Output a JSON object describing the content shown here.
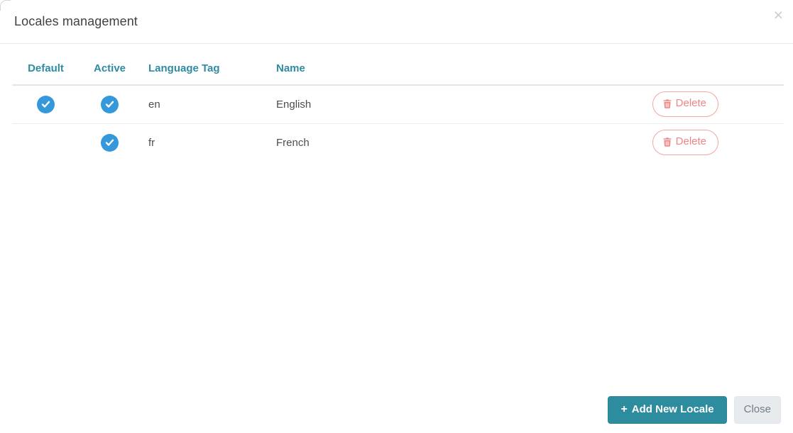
{
  "modal": {
    "title": "Locales management",
    "close_glyph": "×"
  },
  "table": {
    "headers": [
      {
        "label": "Default"
      },
      {
        "label": "Active"
      },
      {
        "label": "Language Tag"
      },
      {
        "label": "Name"
      },
      {
        "label": ""
      }
    ],
    "rows": [
      {
        "default": true,
        "active": true,
        "language_tag": "en",
        "name": "English",
        "delete_label": "Delete"
      },
      {
        "default": false,
        "active": true,
        "language_tag": "fr",
        "name": "French",
        "delete_label": "Delete"
      }
    ]
  },
  "footer": {
    "add_plus": "+",
    "add_label": "Add New Locale",
    "close_label": "Close"
  },
  "colors": {
    "header_teal": "#2e8ba0",
    "button_teal": "#2d8c9d",
    "check_blue": "#3598db",
    "delete_red": "#f08585"
  }
}
